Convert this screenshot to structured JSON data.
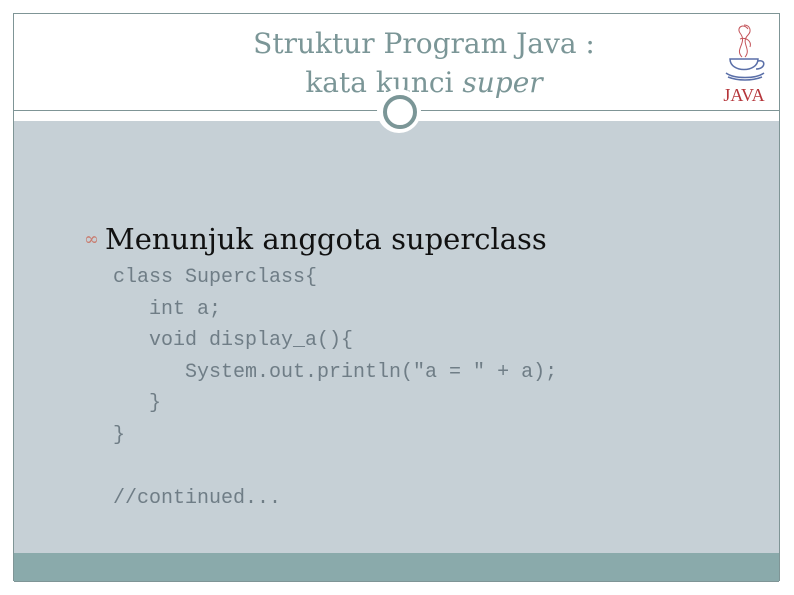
{
  "slide": {
    "title_line1": "Struktur Program Java :",
    "title_line2_prefix": "kata kunci ",
    "title_line2_italic": "super",
    "logo_text": "JAVA",
    "bullet_icon": "∞",
    "bullet_text": "Menunjuk anggota superclass",
    "code_lines": [
      "class Superclass{",
      "   int a;",
      "   void display_a(){",
      "      System.out.println(\"a = \" + a);",
      "   }",
      "}",
      "",
      "//continued..."
    ]
  },
  "colors": {
    "title": "#7b9697",
    "body_bg": "#c6d0d6",
    "footer_bg": "#8aaaab",
    "bullet_icon": "#c97b6e",
    "logo_red": "#b5353a",
    "logo_blue": "#5a6fa8"
  }
}
